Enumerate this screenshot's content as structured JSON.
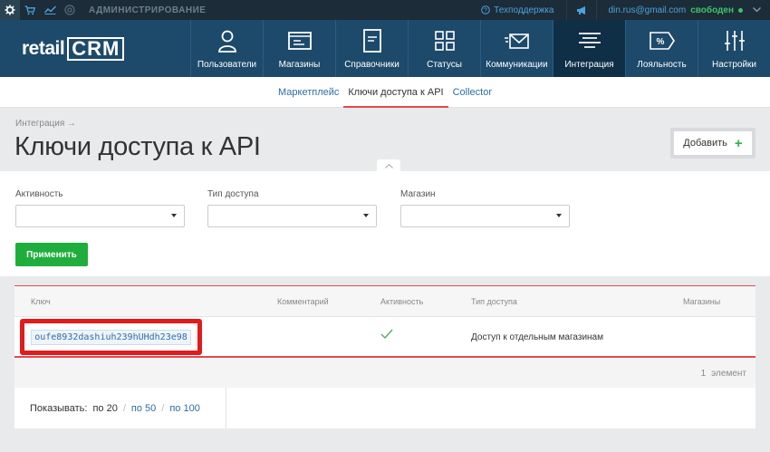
{
  "topbar": {
    "admin_label": "АДМИНИСТРИРОВАНИЕ",
    "support_label": "Техподдержка",
    "user_email": "din.rus@gmail.com",
    "user_status": "свободен",
    "icons": [
      "gear-icon",
      "cart-icon",
      "chart-icon",
      "target-icon"
    ]
  },
  "logo": {
    "part1": "retail",
    "part2": "CRM"
  },
  "nav": {
    "items": [
      {
        "label": "Пользователи",
        "icon": "user-icon"
      },
      {
        "label": "Магазины",
        "icon": "shop-icon"
      },
      {
        "label": "Справочники",
        "icon": "document-icon"
      },
      {
        "label": "Статусы",
        "icon": "grid-icon"
      },
      {
        "label": "Коммуникации",
        "icon": "message-icon"
      },
      {
        "label": "Интеграция",
        "icon": "integration-icon",
        "active": true
      },
      {
        "label": "Лояльность",
        "icon": "percent-icon"
      },
      {
        "label": "Настройки",
        "icon": "sliders-icon"
      }
    ]
  },
  "subnav": {
    "items": [
      {
        "label": "Маркетплейс"
      },
      {
        "label": "Ключи доступа к API",
        "active": true
      },
      {
        "label": "Collector"
      }
    ]
  },
  "page": {
    "breadcrumb": "Интеграция →",
    "title": "Ключи доступа к API",
    "add_button": "Добавить"
  },
  "filters": {
    "activity_label": "Активность",
    "access_type_label": "Тип доступа",
    "shop_label": "Магазин",
    "apply_button": "Применить"
  },
  "table": {
    "columns": {
      "key": "Ключ",
      "comment": "Комментарий",
      "activity": "Активность",
      "access_type": "Тип доступа",
      "shops": "Магазины"
    },
    "rows": [
      {
        "key": "oufe8932dashiuh239hUHdh23e98",
        "comment": "",
        "access_type": "Доступ к отдельным магазинам",
        "shops": ""
      }
    ],
    "count_num": "1",
    "count_label": "элемент"
  },
  "pager": {
    "show_label": "Показывать:",
    "current": "по 20",
    "option_50": "по 50",
    "option_100": "по 100"
  },
  "colors": {
    "topbar_bg": "#1c2c38",
    "nav_bg": "#1d4a6b",
    "nav_active_bg": "#0f2f47",
    "accent_red": "#e5474f",
    "apply_green": "#1fae3c",
    "link_blue": "#2e6da4",
    "highlight_red": "#e21b1b"
  }
}
